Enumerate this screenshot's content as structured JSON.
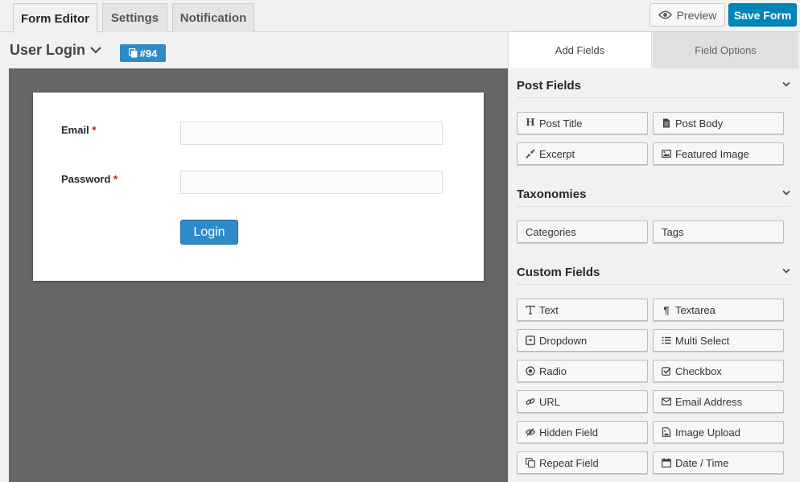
{
  "tabs": [
    {
      "label": "Form Editor",
      "active": true
    },
    {
      "label": "Settings",
      "active": false
    },
    {
      "label": "Notification",
      "active": false
    }
  ],
  "actions": {
    "preview": "Preview",
    "save": "Save Form"
  },
  "form": {
    "title": "User Login",
    "id_badge": "#94"
  },
  "login_form": {
    "email_label": "Email",
    "password_label": "Password",
    "required_mark": "*",
    "email_value": "",
    "password_value": "",
    "submit": "Login"
  },
  "panel": {
    "tabs": {
      "add": "Add Fields",
      "options": "Field Options"
    },
    "post_fields": {
      "title": "Post Fields",
      "items": [
        {
          "label": "Post Title",
          "icon": "heading-icon"
        },
        {
          "label": "Post Body",
          "icon": "document-icon"
        },
        {
          "label": "Excerpt",
          "icon": "compress-icon"
        },
        {
          "label": "Featured Image",
          "icon": "image-icon"
        }
      ]
    },
    "taxonomies": {
      "title": "Taxonomies",
      "items": [
        {
          "label": "Categories"
        },
        {
          "label": "Tags"
        }
      ]
    },
    "custom_fields": {
      "title": "Custom Fields",
      "items": [
        {
          "label": "Text",
          "icon": "text-icon"
        },
        {
          "label": "Textarea",
          "icon": "paragraph-icon"
        },
        {
          "label": "Dropdown",
          "icon": "dropdown-icon"
        },
        {
          "label": "Multi Select",
          "icon": "list-icon"
        },
        {
          "label": "Radio",
          "icon": "radio-icon"
        },
        {
          "label": "Checkbox",
          "icon": "checkbox-icon"
        },
        {
          "label": "URL",
          "icon": "link-icon"
        },
        {
          "label": "Email Address",
          "icon": "envelope-icon"
        },
        {
          "label": "Hidden Field",
          "icon": "eye-slash-icon"
        },
        {
          "label": "Image Upload",
          "icon": "image-file-icon"
        },
        {
          "label": "Repeat Field",
          "icon": "copy-icon"
        },
        {
          "label": "Date / Time",
          "icon": "calendar-icon"
        }
      ]
    }
  }
}
